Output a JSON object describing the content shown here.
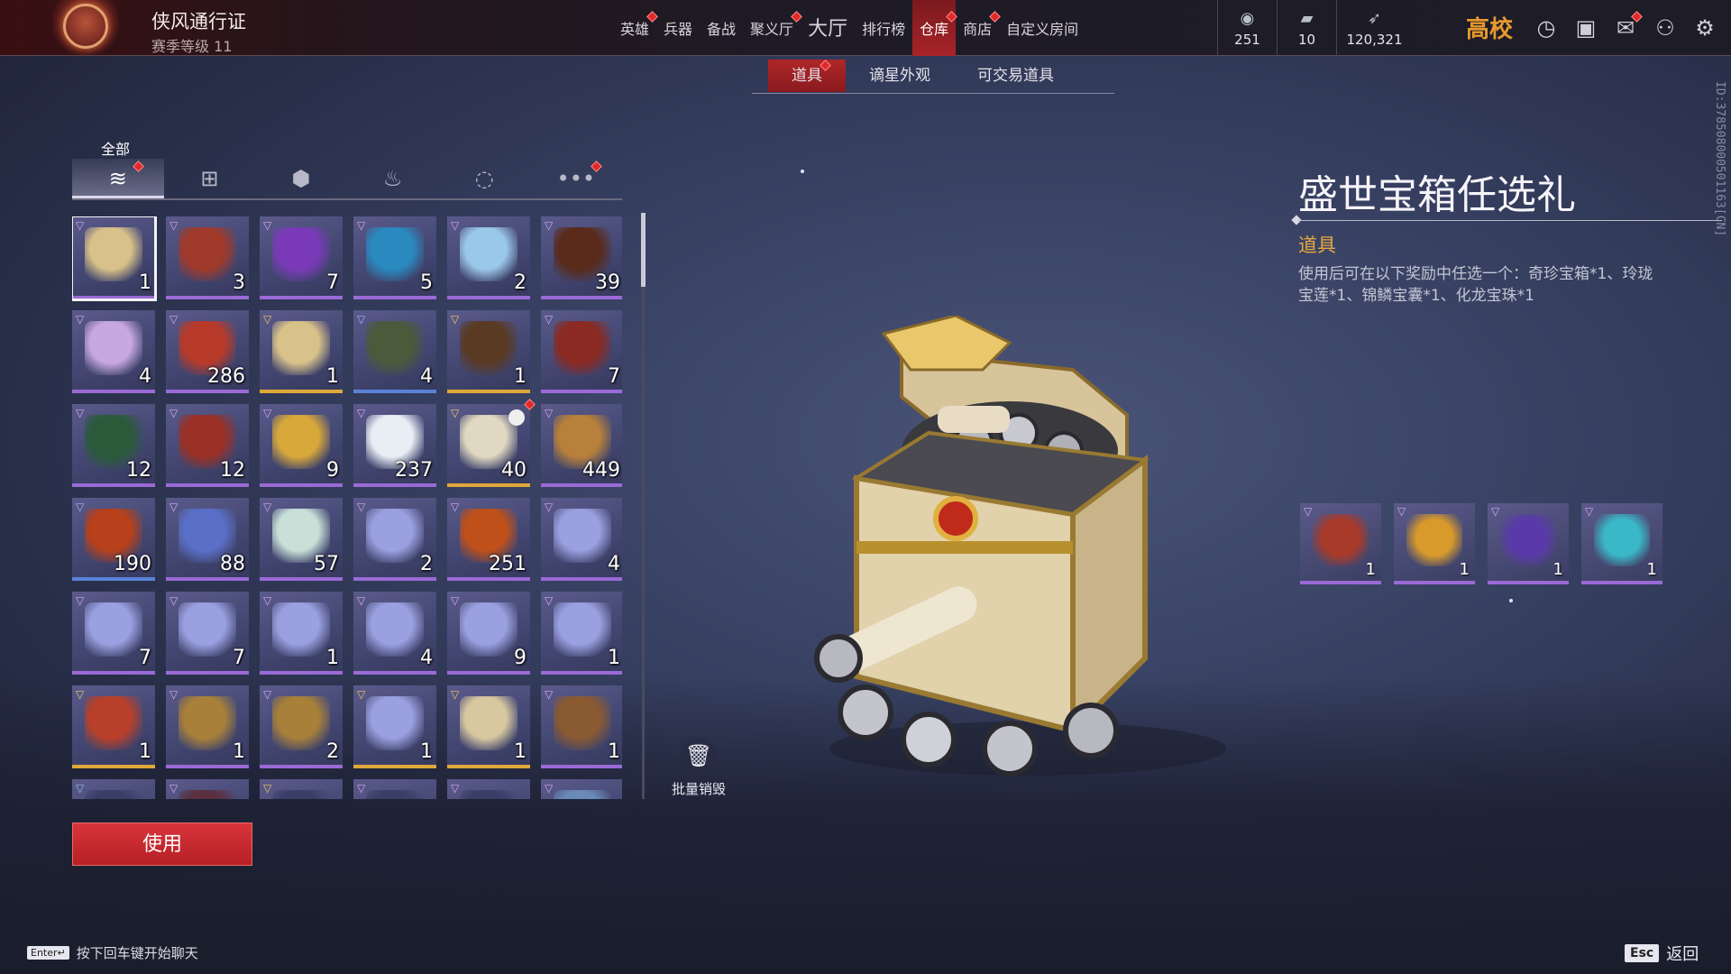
{
  "topbar": {
    "pass_title": "侠风通行证",
    "pass_level": "赛季等级 11",
    "nav": [
      {
        "label": "英雄",
        "dot": true,
        "big": false,
        "active": false
      },
      {
        "label": "兵器",
        "dot": false,
        "big": false,
        "active": false
      },
      {
        "label": "备战",
        "dot": false,
        "big": false,
        "active": false
      },
      {
        "label": "聚义厅",
        "dot": true,
        "big": false,
        "active": false
      },
      {
        "label": "大厅",
        "dot": false,
        "big": true,
        "active": false
      },
      {
        "label": "排行榜",
        "dot": false,
        "big": false,
        "active": false
      },
      {
        "label": "仓库",
        "dot": true,
        "big": false,
        "active": true
      },
      {
        "label": "商店",
        "dot": true,
        "big": false,
        "active": false
      },
      {
        "label": "自定义房间",
        "dot": false,
        "big": false,
        "active": false
      }
    ],
    "currencies": [
      {
        "icon": "coin-icon",
        "value": "251"
      },
      {
        "icon": "ticket-icon",
        "value": "10"
      },
      {
        "icon": "feather-icon",
        "value": "120,321"
      }
    ],
    "school_label": "高校",
    "system_icons": [
      "clock-icon",
      "help-icon",
      "mail-icon",
      "friends-icon",
      "settings-icon"
    ]
  },
  "subtabs": [
    {
      "label": "道具",
      "active": true,
      "dot": true
    },
    {
      "label": "谪星外观",
      "active": false,
      "dot": false
    },
    {
      "label": "可交易道具",
      "active": false,
      "dot": false
    }
  ],
  "inventory": {
    "all_label": "全部",
    "categories": [
      {
        "icon": "layers-icon",
        "glyph": "≋",
        "active": true,
        "dot": true
      },
      {
        "icon": "gift-icon",
        "glyph": "⊞",
        "active": false,
        "dot": false
      },
      {
        "icon": "badge-icon",
        "glyph": "⬢",
        "active": false,
        "dot": false
      },
      {
        "icon": "flame-icon",
        "glyph": "♨",
        "active": false,
        "dot": false
      },
      {
        "icon": "swirl-icon",
        "glyph": "◌",
        "active": false,
        "dot": false
      },
      {
        "icon": "more-icon",
        "glyph": "•••",
        "active": false,
        "dot": true
      }
    ],
    "items": [
      {
        "name": "treasure-chest-white",
        "qty": "1",
        "rarity": "purple",
        "color": "#d9c28a",
        "selected": true
      },
      {
        "name": "treasure-chest-red",
        "qty": "3",
        "rarity": "purple",
        "color": "#a03a2a"
      },
      {
        "name": "purple-armor",
        "qty": "7",
        "rarity": "purple",
        "color": "#7a3ab8"
      },
      {
        "name": "blue-armor",
        "qty": "5",
        "rarity": "purple",
        "color": "#2a8ac0"
      },
      {
        "name": "ice-crystal",
        "qty": "2",
        "rarity": "purple",
        "color": "#9ac8e8"
      },
      {
        "name": "wood-drum",
        "qty": "39",
        "rarity": "purple",
        "color": "#5a2a1a"
      },
      {
        "name": "spirit-egg",
        "qty": "4",
        "rarity": "purple",
        "color": "#c8a8e0"
      },
      {
        "name": "red-hammer",
        "qty": "286",
        "rarity": "purple",
        "color": "#b83a2a"
      },
      {
        "name": "treasure-chest-white",
        "qty": "1",
        "rarity": "gold",
        "color": "#d9c28a"
      },
      {
        "name": "jade-chest",
        "qty": "4",
        "rarity": "blue",
        "color": "#4a5a3a"
      },
      {
        "name": "lacquer-chest",
        "qty": "1",
        "rarity": "gold",
        "color": "#5a3a22"
      },
      {
        "name": "red-box",
        "qty": "7",
        "rarity": "purple",
        "color": "#8a2a22"
      },
      {
        "name": "green-case",
        "qty": "12",
        "rarity": "purple",
        "color": "#2a5a3a"
      },
      {
        "name": "red-case",
        "qty": "12",
        "rarity": "purple",
        "color": "#9a3026"
      },
      {
        "name": "gold-coin",
        "qty": "9",
        "rarity": "purple",
        "color": "#d8a83a"
      },
      {
        "name": "white-pearl",
        "qty": "237",
        "rarity": "purple",
        "color": "#e8eef4"
      },
      {
        "name": "bone-key",
        "qty": "40",
        "rarity": "gold",
        "color": "#e0d8c0",
        "timer": true,
        "dot": true
      },
      {
        "name": "bronze-coin",
        "qty": "449",
        "rarity": "purple",
        "color": "#b8803a"
      },
      {
        "name": "fire-mask",
        "qty": "190",
        "rarity": "blue",
        "color": "#b8401a"
      },
      {
        "name": "blue-coin",
        "qty": "88",
        "rarity": "purple",
        "color": "#5a70c8"
      },
      {
        "name": "lotus",
        "qty": "57",
        "rarity": "purple",
        "color": "#c8e0d8"
      },
      {
        "name": "gift-box",
        "qty": "2",
        "rarity": "purple",
        "color": "#9aa0e0"
      },
      {
        "name": "fire-gem",
        "qty": "251",
        "rarity": "purple",
        "color": "#c0501a"
      },
      {
        "name": "gift-box",
        "qty": "4",
        "rarity": "purple",
        "color": "#9aa0e0"
      },
      {
        "name": "gift-box",
        "qty": "7",
        "rarity": "purple",
        "color": "#9aa0e0"
      },
      {
        "name": "gift-box",
        "qty": "7",
        "rarity": "purple",
        "color": "#9aa0e0"
      },
      {
        "name": "gift-box",
        "qty": "1",
        "rarity": "purple",
        "color": "#9aa0e0"
      },
      {
        "name": "gift-box",
        "qty": "4",
        "rarity": "purple",
        "color": "#9aa0e0"
      },
      {
        "name": "gift-box",
        "qty": "9",
        "rarity": "purple",
        "color": "#9aa0e0"
      },
      {
        "name": "gift-box",
        "qty": "1",
        "rarity": "purple",
        "color": "#9aa0e0"
      },
      {
        "name": "treasure-chest-red",
        "qty": "1",
        "rarity": "gold",
        "color": "#b8402a"
      },
      {
        "name": "gold-chest",
        "qty": "1",
        "rarity": "purple",
        "color": "#a8803a"
      },
      {
        "name": "gold-chest",
        "qty": "2",
        "rarity": "purple",
        "color": "#a8803a"
      },
      {
        "name": "gift-box",
        "qty": "1",
        "rarity": "gold",
        "color": "#9aa0e0"
      },
      {
        "name": "white-chest",
        "qty": "1",
        "rarity": "gold",
        "color": "#d8c8a0"
      },
      {
        "name": "wood-chest",
        "qty": "1",
        "rarity": "purple",
        "color": "#8a5a32"
      },
      {
        "name": "partial-item",
        "qty": "",
        "rarity": "blue",
        "color": "#3a3e66"
      },
      {
        "name": "partial-item",
        "qty": "",
        "rarity": "purple",
        "color": "#5a3040"
      },
      {
        "name": "partial-item",
        "qty": "",
        "rarity": "gold",
        "color": "#3a3e66"
      },
      {
        "name": "partial-item",
        "qty": "",
        "rarity": "purple",
        "color": "#3a3e66"
      },
      {
        "name": "partial-item",
        "qty": "",
        "rarity": "purple",
        "color": "#3a3e66"
      },
      {
        "name": "partial-item",
        "qty": "",
        "rarity": "purple",
        "color": "#6a8ab8"
      }
    ],
    "bulk_destroy_label": "批量销毁",
    "use_label": "使用"
  },
  "detail": {
    "title": "盛世宝箱任选礼",
    "type": "道具",
    "description": "使用后可在以下奖励中任选一个：奇珍宝箱*1、玲珑宝莲*1、锦鳞宝囊*1、化龙宝珠*1",
    "rewards": [
      {
        "name": "treasure-chest",
        "qty": "1",
        "color": "#a83a2a"
      },
      {
        "name": "lotus-bowl",
        "qty": "1",
        "color": "#d89a2a"
      },
      {
        "name": "pouch",
        "qty": "1",
        "color": "#5a3aa8"
      },
      {
        "name": "dragon-orb",
        "qty": "1",
        "color": "#3ab8c8"
      }
    ],
    "side_id": "ID:378508000501163[CN]"
  },
  "footer": {
    "enter_key": "Enter↵",
    "chat_hint": "按下回车键开始聊天",
    "esc_key": "Esc",
    "back_label": "返回"
  }
}
